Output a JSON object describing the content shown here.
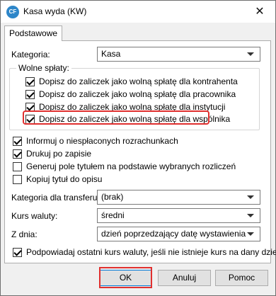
{
  "window": {
    "title": "Kasa wyda (KW)",
    "icon_text": "CF",
    "close_symbol": "✕"
  },
  "tabs": [
    {
      "label": "Podstawowe"
    }
  ],
  "kategoria": {
    "label": "Kategoria:",
    "value": "Kasa"
  },
  "wolne_splaty": {
    "title": "Wolne spłaty:",
    "items": [
      {
        "label": "Dopisz do zaliczek jako wolną spłatę dla kontrahenta",
        "checked": true
      },
      {
        "label": "Dopisz do zaliczek jako wolną spłatę dla pracownika",
        "checked": true
      },
      {
        "label": "Dopisz do zaliczek jako wolną spłatę dla instytucji",
        "checked": true
      },
      {
        "label": "Dopisz do zaliczek jako wolną spłatę dla wspólnika",
        "checked": true
      }
    ]
  },
  "options": [
    {
      "label": "Informuj o niespłaconych rozrachunkach",
      "checked": true
    },
    {
      "label": "Drukuj po zapisie",
      "checked": true
    },
    {
      "label": "Generuj pole tytułem na podstawie wybranych rozliczeń",
      "checked": false
    },
    {
      "label": "Kopiuj tytuł do opisu",
      "checked": false
    }
  ],
  "kategoria_transferu": {
    "label": "Kategoria dla transferu:",
    "value": "(brak)"
  },
  "kurs_waluty": {
    "label": "Kurs waluty:",
    "value": "średni"
  },
  "z_dnia": {
    "label": "Z dnia:",
    "value": "dzień poprzedzający datę wystawienia"
  },
  "podpowiadaj": {
    "label": "Podpowiadaj ostatni kurs waluty, jeśli nie istnieje kurs na dany dzień",
    "checked": true
  },
  "buttons": {
    "ok": "OK",
    "cancel": "Anuluj",
    "help": "Pomoc"
  },
  "colors": {
    "highlight": "#e0302f",
    "accent": "#0078d7"
  }
}
